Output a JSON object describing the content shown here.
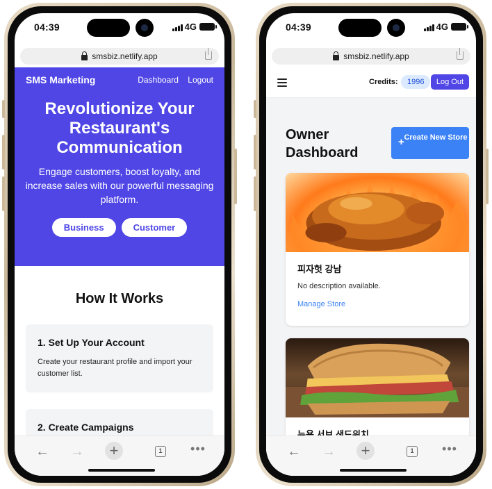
{
  "status": {
    "time": "04:39",
    "network": "4G"
  },
  "browser": {
    "url": "smsbiz.netlify.app",
    "tab_count": "1"
  },
  "landing": {
    "brand": "SMS Marketing",
    "nav": [
      "Dashboard",
      "Logout"
    ],
    "hero_title": "Revolutionize Your Restaurant's Communication",
    "hero_subtitle": "Engage customers, boost loyalty, and increase sales with our powerful messaging platform.",
    "buttons": [
      "Business",
      "Customer"
    ],
    "section_title": "How It Works",
    "steps": [
      {
        "title": "1. Set Up Your Account",
        "text": "Create your restaurant profile and import your customer list."
      },
      {
        "title": "2. Create Campaigns",
        "text": ""
      }
    ]
  },
  "dashboard": {
    "credits_label": "Credits:",
    "credits_value": "1996",
    "logout_label": "Log Out",
    "title": "Owner Dashboard",
    "create_label": "Create New Store",
    "stores": [
      {
        "name": "피자헛 강남",
        "description": "No description available.",
        "link": "Manage Store",
        "image": "roast-chicken"
      },
      {
        "name": "뉴욕 서브 샌드위치",
        "description": "",
        "link": "",
        "image": "sandwich"
      }
    ]
  },
  "colors": {
    "primary": "#4f46e5",
    "blue": "#3b82f6",
    "credits_bg": "#dbeafe"
  }
}
